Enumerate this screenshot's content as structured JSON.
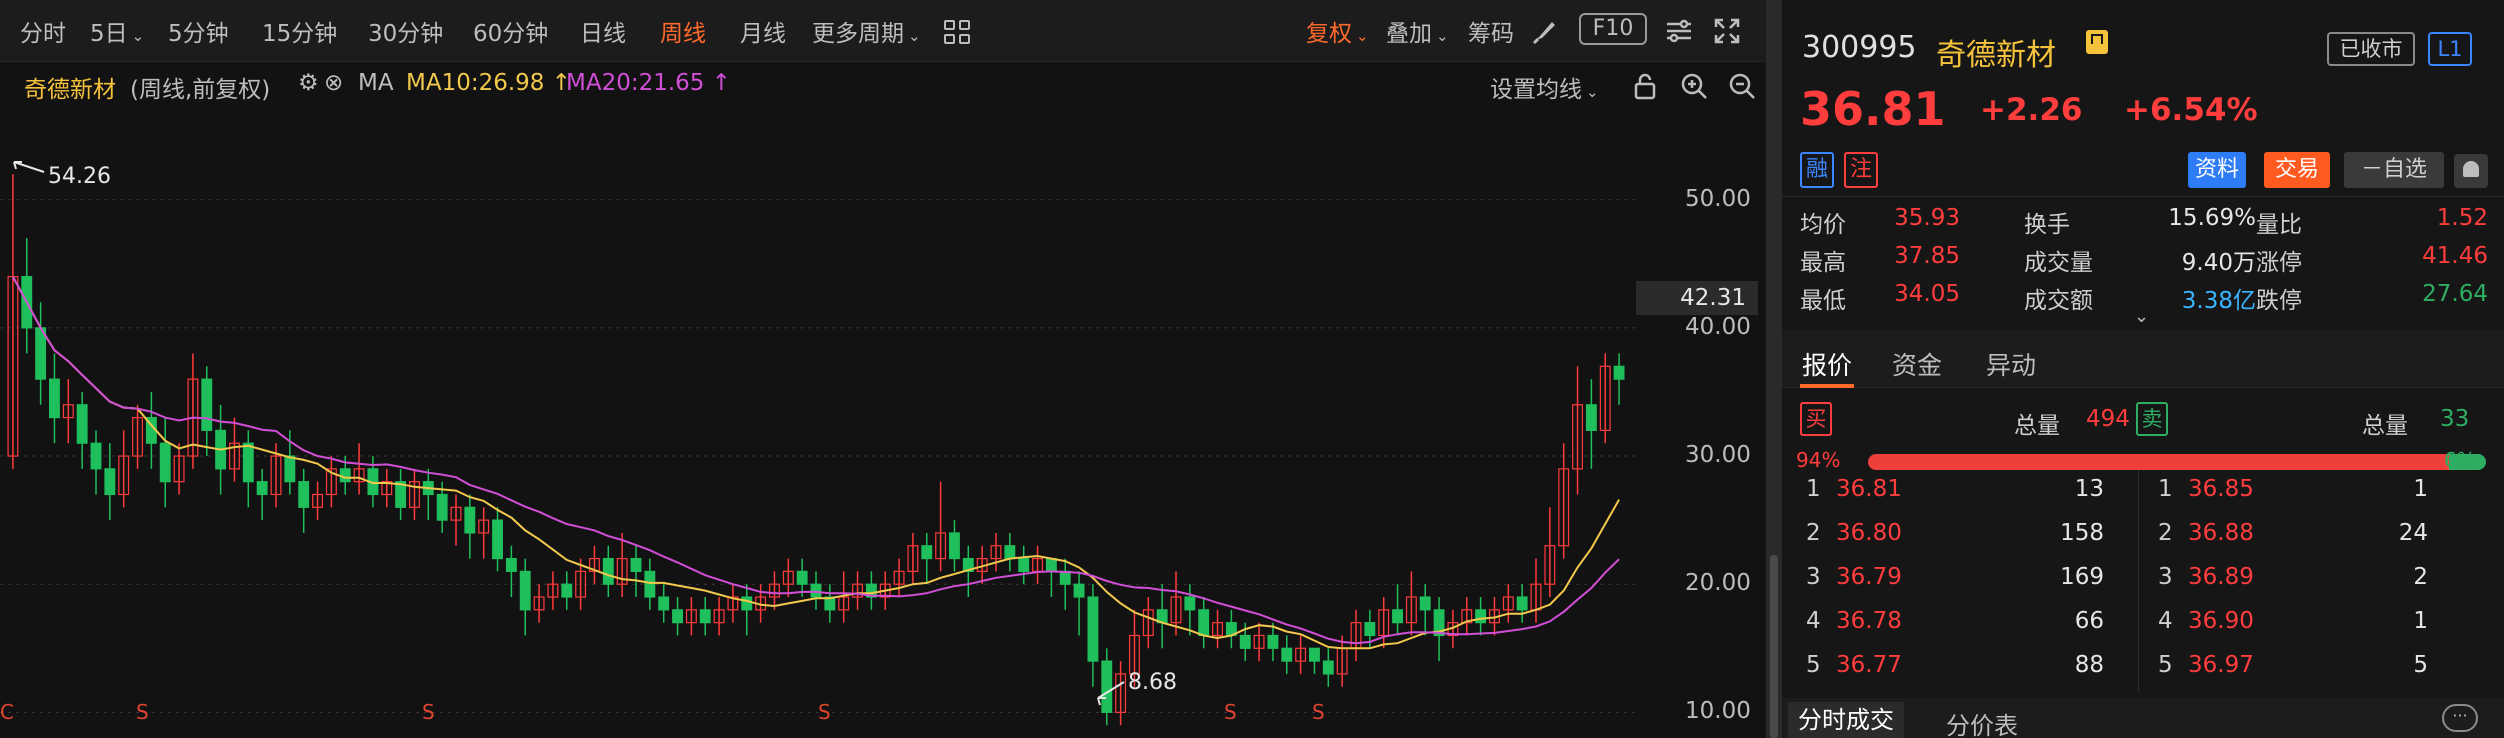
{
  "toolbar": {
    "periods": [
      {
        "label": "分时",
        "caret": false,
        "active": false
      },
      {
        "label": "5日",
        "caret": true,
        "active": false
      },
      {
        "label": "5分钟",
        "caret": false,
        "active": false
      },
      {
        "label": "15分钟",
        "caret": false,
        "active": false
      },
      {
        "label": "30分钟",
        "caret": false,
        "active": false
      },
      {
        "label": "60分钟",
        "caret": false,
        "active": false
      },
      {
        "label": "日线",
        "caret": false,
        "active": false
      },
      {
        "label": "周线",
        "caret": false,
        "active": true
      },
      {
        "label": "月线",
        "caret": false,
        "active": false
      },
      {
        "label": "更多周期",
        "caret": true,
        "active": false
      }
    ],
    "restore_rights": "复权",
    "overlay": "叠加",
    "chips": "筹码",
    "f10": "F10"
  },
  "legend": {
    "stock_name": "奇德新材",
    "mode": "(周线,前复权)",
    "ma_label": "MA",
    "ma10": "MA10:26.98",
    "ma20": "MA20:21.65",
    "ma10_arrow": "↑",
    "ma20_arrow": "↑",
    "ma10_color": "#f2c94c",
    "ma20_color": "#d14fd6",
    "set_ma": "设置均线"
  },
  "chart_data": {
    "type": "candlestick",
    "period": "weekly",
    "ylim": [
      8,
      57
    ],
    "yticks": [
      "50.00",
      "40.00",
      "30.00",
      "20.00",
      "10.00"
    ],
    "ytick_values": [
      50,
      40,
      30,
      20,
      10
    ],
    "current_price_label": "42.31",
    "current_price_value": 42.31,
    "high_annotation": "54.26",
    "low_annotation": "8.68",
    "event_markers": [
      "C",
      "S",
      "S",
      "S",
      "S",
      "S"
    ],
    "up_color": "#ff3b3b",
    "down_color": "#1fbf5b",
    "ohlc": [
      [
        30,
        44,
        29,
        52
      ],
      [
        44,
        40,
        38,
        47
      ],
      [
        40,
        36,
        34,
        42
      ],
      [
        36,
        33,
        31,
        38
      ],
      [
        33,
        34,
        31,
        36
      ],
      [
        34,
        31,
        29,
        35
      ],
      [
        31,
        29,
        27,
        32
      ],
      [
        29,
        27,
        25,
        31
      ],
      [
        27,
        30,
        26,
        32
      ],
      [
        30,
        33,
        29,
        34
      ],
      [
        33,
        31,
        29,
        35
      ],
      [
        31,
        28,
        26,
        33
      ],
      [
        28,
        30,
        27,
        31
      ],
      [
        30,
        36,
        29,
        38
      ],
      [
        36,
        32,
        30,
        37
      ],
      [
        32,
        29,
        27,
        34
      ],
      [
        29,
        31,
        28,
        33
      ],
      [
        31,
        28,
        26,
        32
      ],
      [
        28,
        27,
        25,
        29
      ],
      [
        27,
        30,
        26,
        31
      ],
      [
        30,
        28,
        27,
        32
      ],
      [
        28,
        26,
        24,
        29
      ],
      [
        26,
        27,
        25,
        28
      ],
      [
        27,
        29,
        26,
        30
      ],
      [
        29,
        28,
        27,
        30
      ],
      [
        28,
        29,
        27,
        31
      ],
      [
        29,
        27,
        26,
        30
      ],
      [
        27,
        28,
        26,
        29
      ],
      [
        28,
        26,
        25,
        29
      ],
      [
        26,
        28,
        25,
        29
      ],
      [
        28,
        27,
        25,
        29
      ],
      [
        27,
        25,
        24,
        28
      ],
      [
        25,
        26,
        23,
        27
      ],
      [
        26,
        24,
        22,
        27
      ],
      [
        24,
        25,
        22,
        26
      ],
      [
        25,
        22,
        21,
        26
      ],
      [
        22,
        21,
        19,
        23
      ],
      [
        21,
        18,
        16,
        22
      ],
      [
        18,
        19,
        17,
        20
      ],
      [
        19,
        20,
        18,
        21
      ],
      [
        20,
        19,
        18,
        21
      ],
      [
        19,
        21,
        18,
        22
      ],
      [
        21,
        22,
        20,
        23
      ],
      [
        22,
        20,
        19,
        23
      ],
      [
        20,
        22,
        19,
        24
      ],
      [
        22,
        21,
        19,
        23
      ],
      [
        21,
        19,
        18,
        22
      ],
      [
        19,
        18,
        17,
        20
      ],
      [
        18,
        17,
        16,
        19
      ],
      [
        17,
        18,
        16,
        19
      ],
      [
        18,
        17,
        16,
        19
      ],
      [
        17,
        18,
        16,
        19
      ],
      [
        18,
        19,
        17,
        20
      ],
      [
        19,
        18,
        16,
        20
      ],
      [
        18,
        19,
        17,
        20
      ],
      [
        19,
        20,
        18,
        21
      ],
      [
        20,
        21,
        19,
        22
      ],
      [
        21,
        20,
        19,
        22
      ],
      [
        20,
        19,
        18,
        21
      ],
      [
        19,
        18,
        17,
        20
      ],
      [
        18,
        19,
        17,
        21
      ],
      [
        19,
        20,
        18,
        21
      ],
      [
        20,
        19,
        18,
        21
      ],
      [
        19,
        20,
        18,
        21
      ],
      [
        20,
        21,
        19,
        22
      ],
      [
        21,
        23,
        20,
        24
      ],
      [
        23,
        22,
        20,
        24
      ],
      [
        22,
        24,
        21,
        28
      ],
      [
        24,
        22,
        21,
        25
      ],
      [
        22,
        21,
        19,
        23
      ],
      [
        21,
        22,
        20,
        23
      ],
      [
        22,
        23,
        21,
        24
      ],
      [
        23,
        22,
        21,
        24
      ],
      [
        22,
        21,
        20,
        23
      ],
      [
        21,
        22,
        20,
        23
      ],
      [
        22,
        21,
        19,
        22
      ],
      [
        21,
        20,
        18,
        22
      ],
      [
        20,
        19,
        16,
        21
      ],
      [
        19,
        14,
        12,
        20
      ],
      [
        14,
        10,
        9,
        15
      ],
      [
        10,
        13,
        9,
        14
      ],
      [
        13,
        16,
        12,
        18
      ],
      [
        16,
        18,
        15,
        19
      ],
      [
        18,
        17,
        15,
        20
      ],
      [
        17,
        19,
        16,
        21
      ],
      [
        19,
        18,
        16,
        20
      ],
      [
        18,
        16,
        15,
        19
      ],
      [
        16,
        17,
        15,
        18
      ],
      [
        17,
        16,
        15,
        18
      ],
      [
        16,
        15,
        14,
        17
      ],
      [
        15,
        16,
        14,
        17
      ],
      [
        16,
        15,
        14,
        17
      ],
      [
        15,
        14,
        13,
        16
      ],
      [
        14,
        15,
        13,
        16
      ],
      [
        15,
        14,
        13,
        15
      ],
      [
        14,
        13,
        12,
        15
      ],
      [
        13,
        15,
        12,
        16
      ],
      [
        15,
        17,
        14,
        18
      ],
      [
        17,
        16,
        15,
        18
      ],
      [
        16,
        18,
        15,
        19
      ],
      [
        18,
        17,
        16,
        20
      ],
      [
        17,
        19,
        16,
        21
      ],
      [
        19,
        18,
        16,
        20
      ],
      [
        18,
        16,
        14,
        19
      ],
      [
        16,
        17,
        15,
        18
      ],
      [
        17,
        18,
        16,
        19
      ],
      [
        18,
        17,
        16,
        19
      ],
      [
        17,
        18,
        16,
        19
      ],
      [
        18,
        19,
        17,
        20
      ],
      [
        19,
        18,
        17,
        20
      ],
      [
        18,
        20,
        17,
        22
      ],
      [
        20,
        23,
        19,
        26
      ],
      [
        23,
        29,
        22,
        31
      ],
      [
        29,
        34,
        27,
        37
      ],
      [
        34,
        32,
        29,
        36
      ],
      [
        32,
        37,
        31,
        38
      ],
      [
        37,
        36,
        34,
        38
      ]
    ]
  },
  "quote": {
    "code": "300995",
    "name": "奇德新材",
    "market_status": "已收市",
    "level": "L1",
    "price": "36.81",
    "change": "+2.26",
    "change_pct": "+6.54%",
    "tag_margin": "融",
    "tag_note": "注",
    "btn_info": "资料",
    "btn_trade": "交易",
    "btn_watch": "－自选"
  },
  "stats": [
    [
      {
        "label": "均价",
        "value": "35.93",
        "color": "#ff3d3d"
      },
      {
        "label": "换手",
        "value": "15.69%",
        "color": "#e6e6e6"
      },
      {
        "label": "量比",
        "value": "1.52",
        "color": "#ff3d3d"
      }
    ],
    [
      {
        "label": "最高",
        "value": "37.85",
        "color": "#ff3d3d"
      },
      {
        "label": "成交量",
        "value": "9.40万",
        "color": "#e6e6e6"
      },
      {
        "label": "涨停",
        "value": "41.46",
        "color": "#ff3d3d"
      }
    ],
    [
      {
        "label": "最低",
        "value": "34.05",
        "color": "#ff3d3d"
      },
      {
        "label": "成交额",
        "value": "3.38亿",
        "color": "#3bb4ff"
      },
      {
        "label": "跌停",
        "value": "27.64",
        "color": "#2eae63"
      }
    ]
  ],
  "tabs": [
    "报价",
    "资金",
    "异动"
  ],
  "buy_sell": {
    "buy_tag": "买",
    "sell_tag": "卖",
    "total_label": "总量",
    "buy_total": "494",
    "sell_total": "33",
    "buy_pct": "94%",
    "sell_pct": "6%",
    "buy_ratio": 0.94
  },
  "order_book": {
    "bids": [
      {
        "level": "1",
        "price": "36.81",
        "volume": "13"
      },
      {
        "level": "2",
        "price": "36.80",
        "volume": "158"
      },
      {
        "level": "3",
        "price": "36.79",
        "volume": "169"
      },
      {
        "level": "4",
        "price": "36.78",
        "volume": "66"
      },
      {
        "level": "5",
        "price": "36.77",
        "volume": "88"
      }
    ],
    "asks": [
      {
        "level": "1",
        "price": "36.85",
        "volume": "1"
      },
      {
        "level": "2",
        "price": "36.88",
        "volume": "24"
      },
      {
        "level": "3",
        "price": "36.89",
        "volume": "2"
      },
      {
        "level": "4",
        "price": "36.90",
        "volume": "1"
      },
      {
        "level": "5",
        "price": "36.97",
        "volume": "5"
      }
    ]
  },
  "bottom_tabs": [
    "分时成交",
    "分价表"
  ],
  "more_label": "···"
}
